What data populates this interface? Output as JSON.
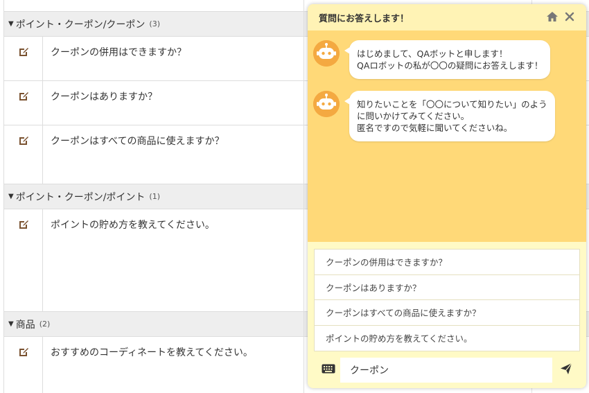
{
  "faq": {
    "categories": [
      {
        "label": "ポイント・クーポン/クーポン",
        "count": "(3)",
        "questions": [
          "クーポンの併用はできますか？",
          "クーポンはありますか？",
          "クーポンはすべての商品に使えますか？"
        ]
      },
      {
        "label": "ポイント・クーポン/ポイント",
        "count": "(1)",
        "questions": [
          "ポイントの貯め方を教えてください。"
        ]
      },
      {
        "label": "商品",
        "count": "(2)",
        "questions": [
          "おすすめのコーディネートを教えてください。"
        ]
      }
    ]
  },
  "chat": {
    "title": "質問にお答えします！",
    "messages": [
      {
        "lines": [
          "はじめまして、QAボットと申します！",
          "QAロボットの私が〇〇の疑問にお答えします！"
        ]
      },
      {
        "lines": [
          "知りたいことを「〇〇について知りたい」のよう",
          "に問いかけてみてください。",
          "匿名ですので気軽に聞いてくださいね。"
        ]
      }
    ],
    "suggestions": [
      "クーポンの併用はできますか？",
      "クーポンはありますか？",
      "クーポンはすべての商品に使えますか？",
      "ポイントの貯め方を教えてください。"
    ],
    "input_value": "クーポン",
    "colors": {
      "header": "#fff3b5",
      "body": "#ffd978",
      "footer": "#fffac6",
      "avatar": "#f4a941",
      "icon": "#666666"
    }
  }
}
